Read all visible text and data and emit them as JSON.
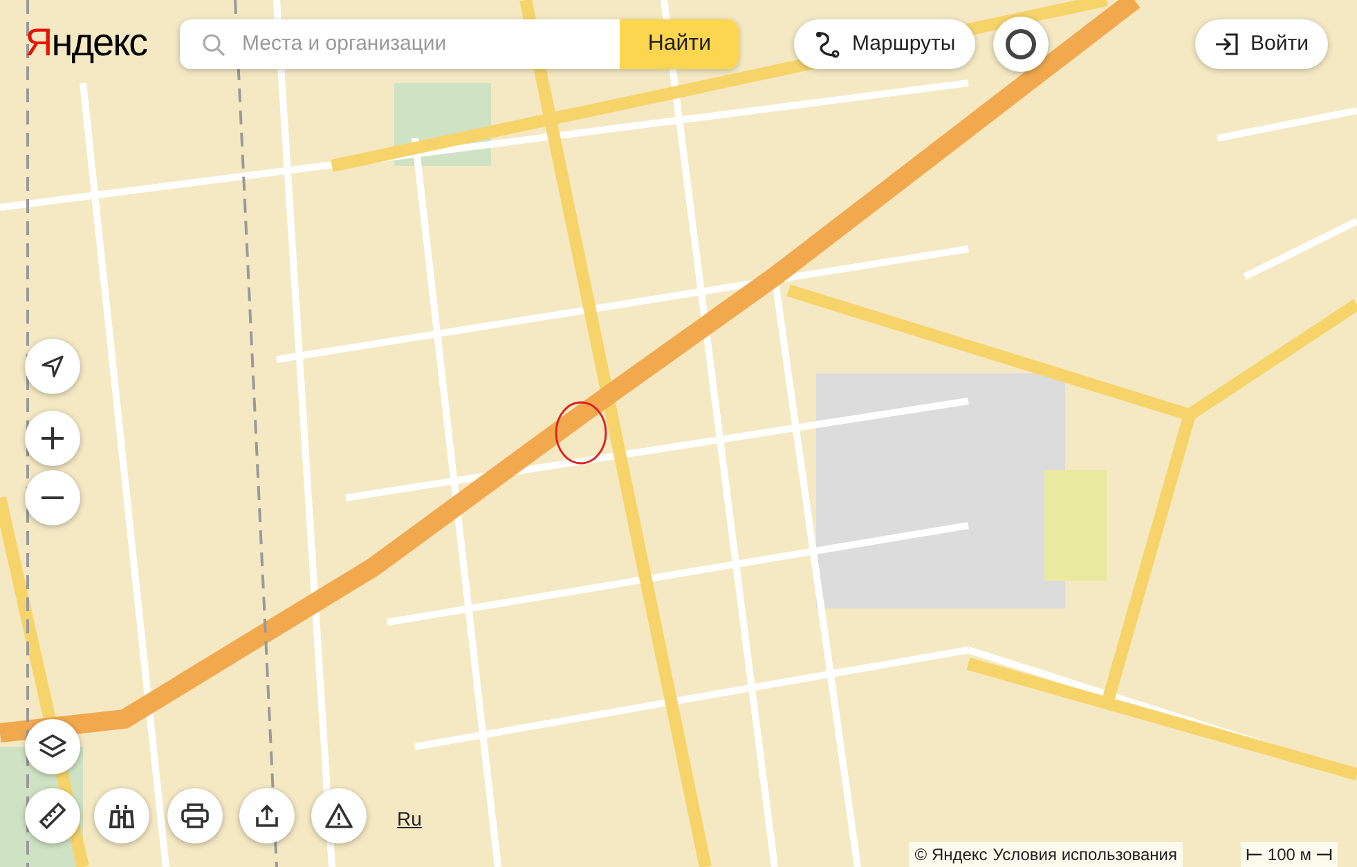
{
  "logo": {
    "text": "Яндекс"
  },
  "search": {
    "placeholder": "Места и организации",
    "button": "Найти"
  },
  "routes_button": "Маршруты",
  "login_button": "Войти",
  "language": "Ru",
  "copyright": "© Яндекс",
  "terms_link": "Условия использования",
  "scale": "100 м"
}
